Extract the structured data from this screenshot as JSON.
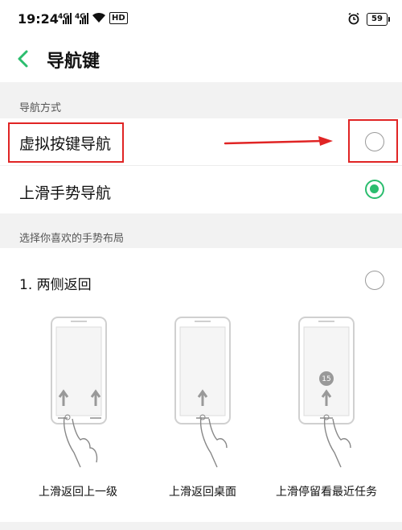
{
  "status_bar": {
    "time": "19:24",
    "signal1": "4G",
    "signal2": "4G",
    "hd_label": "HD",
    "battery": "59",
    "icons": [
      "signal-icon",
      "wifi-icon",
      "hd-icon",
      "alarm-icon",
      "battery-icon"
    ]
  },
  "header": {
    "back_icon": "chevron-left-icon",
    "title": "导航键"
  },
  "navigation_method": {
    "section_label": "导航方式",
    "options": [
      {
        "label": "虚拟按键导航",
        "selected": false
      },
      {
        "label": "上滑手势导航",
        "selected": true
      }
    ]
  },
  "gesture_layout": {
    "section_label": "选择你喜欢的手势布局",
    "option": {
      "label": "1. 两侧返回",
      "selected": false
    },
    "illustrations": [
      {
        "caption": "上滑返回上一级"
      },
      {
        "caption": "上滑返回桌面"
      },
      {
        "caption": "上滑停留看最近任务",
        "badge": "15"
      }
    ]
  },
  "colors": {
    "accent": "#2bbd6e",
    "annotation": "#e02424"
  }
}
